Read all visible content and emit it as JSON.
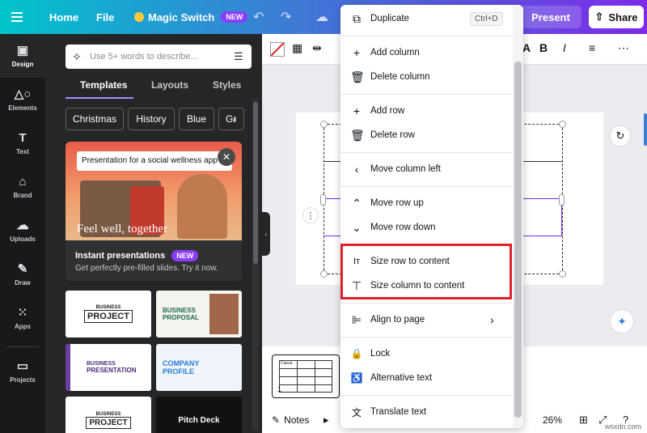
{
  "topbar": {
    "home": "Home",
    "file": "File",
    "magic_switch": "Magic Switch",
    "new_badge": "NEW",
    "present": "Present",
    "share": "Share"
  },
  "rail": [
    {
      "label": "Design",
      "icon": "design-icon"
    },
    {
      "label": "Elements",
      "icon": "elements-icon"
    },
    {
      "label": "Text",
      "icon": "text-icon"
    },
    {
      "label": "Brand",
      "icon": "brand-icon"
    },
    {
      "label": "Uploads",
      "icon": "uploads-icon"
    },
    {
      "label": "Draw",
      "icon": "draw-icon"
    },
    {
      "label": "Apps",
      "icon": "apps-icon"
    },
    {
      "label": "Projects",
      "icon": "projects-icon"
    }
  ],
  "panel": {
    "search_placeholder": "Use 5+ words to describe...",
    "tabs": [
      "Templates",
      "Layouts",
      "Styles"
    ],
    "chips": [
      "Christmas",
      "History",
      "Blue",
      "Gr"
    ],
    "promo": {
      "prompt": "Presentation for a social wellness app",
      "tagline": "Feel well, together",
      "title": "Instant presentations",
      "badge": "NEW",
      "subtitle": "Get perfectly pre-filled slides. Try it now."
    },
    "templates": [
      {
        "line1": "BUSINESS",
        "line2": "PROJECT"
      },
      {
        "line1": "BUSINESS",
        "line2": "PROPOSAL"
      },
      {
        "line1": "BUSINESS",
        "line2": "PRESENTATION"
      },
      {
        "line1": "COMPANY",
        "line2": "PROFILE"
      },
      {
        "line1": "BUSINESS",
        "line2": "PROJECT"
      },
      {
        "line1": "",
        "line2": "Pitch Deck"
      }
    ]
  },
  "editor": {
    "page_number": "1",
    "notes": "Notes",
    "zoom": "26%",
    "thumb_cell": "Canva"
  },
  "menu": {
    "items": [
      {
        "label": "Duplicate",
        "icon": "duplicate-icon",
        "glyph": "⧉",
        "shortcut": "Ctrl+D"
      },
      {
        "label": "Add column",
        "icon": "plus-icon",
        "glyph": "+"
      },
      {
        "label": "Delete column",
        "icon": "trash-icon",
        "glyph": "🗑"
      },
      {
        "label": "Add row",
        "icon": "plus-icon",
        "glyph": "+"
      },
      {
        "label": "Delete row",
        "icon": "trash-icon",
        "glyph": "🗑"
      },
      {
        "label": "Move column left",
        "icon": "chevron-left-icon",
        "glyph": "‹"
      },
      {
        "label": "Move row up",
        "icon": "chevron-up-icon",
        "glyph": "⌃"
      },
      {
        "label": "Move row down",
        "icon": "chevron-down-icon",
        "glyph": "⌄"
      },
      {
        "label": "Size row to content",
        "icon": "size-row-icon",
        "glyph": "Iᴛ"
      },
      {
        "label": "Size column to content",
        "icon": "size-column-icon",
        "glyph": "⊤"
      },
      {
        "label": "Align to page",
        "icon": "align-icon",
        "glyph": "⊫"
      },
      {
        "label": "Lock",
        "icon": "lock-icon",
        "glyph": "🔒"
      },
      {
        "label": "Alternative text",
        "icon": "accessibility-icon",
        "glyph": "♿"
      },
      {
        "label": "Translate text",
        "icon": "translate-icon",
        "glyph": "文"
      }
    ]
  },
  "watermark": "wsxdn.com",
  "colors": {
    "highlight": "#e0202a",
    "accent": "#8b3dff"
  }
}
